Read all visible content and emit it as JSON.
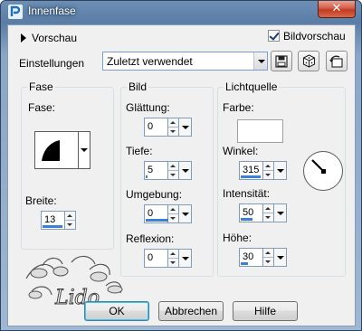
{
  "window": {
    "title": "Innenfase",
    "close_glyph": "✕"
  },
  "preview": {
    "label": "Vorschau",
    "show_image_label": "Bildvorschau",
    "show_image_checked": true
  },
  "settings": {
    "label": "Einstellungen",
    "value": "Zuletzt verwendet"
  },
  "toolbar_icons": [
    "save-icon",
    "dice-icon",
    "reset-icon"
  ],
  "fase": {
    "group_label": "Fase",
    "shape_label": "Fase:",
    "width_label": "Breite:",
    "width_value": "13"
  },
  "bild": {
    "group_label": "Bild",
    "smoothing_label": "Glättung:",
    "smoothing_value": "0",
    "depth_label": "Tiefe:",
    "depth_value": "5",
    "ambience_label": "Umgebung:",
    "ambience_value": "0",
    "reflection_label": "Reflexion:",
    "reflection_value": "0"
  },
  "light": {
    "group_label": "Lichtquelle",
    "color_label": "Farbe:",
    "color": "#ffffff",
    "angle_label": "Winkel:",
    "angle_value": "315",
    "intensity_label": "Intensität:",
    "intensity_value": "50",
    "elevation_label": "Höhe:",
    "elevation_value": "30"
  },
  "buttons": {
    "ok": "OK",
    "cancel": "Abbrechen",
    "help": "Hilfe"
  },
  "watermark_text": "Lido",
  "colors": {
    "slider_fill": "#3c7fd8",
    "title_text": "#ffffff",
    "close_button": "#c13a22"
  }
}
